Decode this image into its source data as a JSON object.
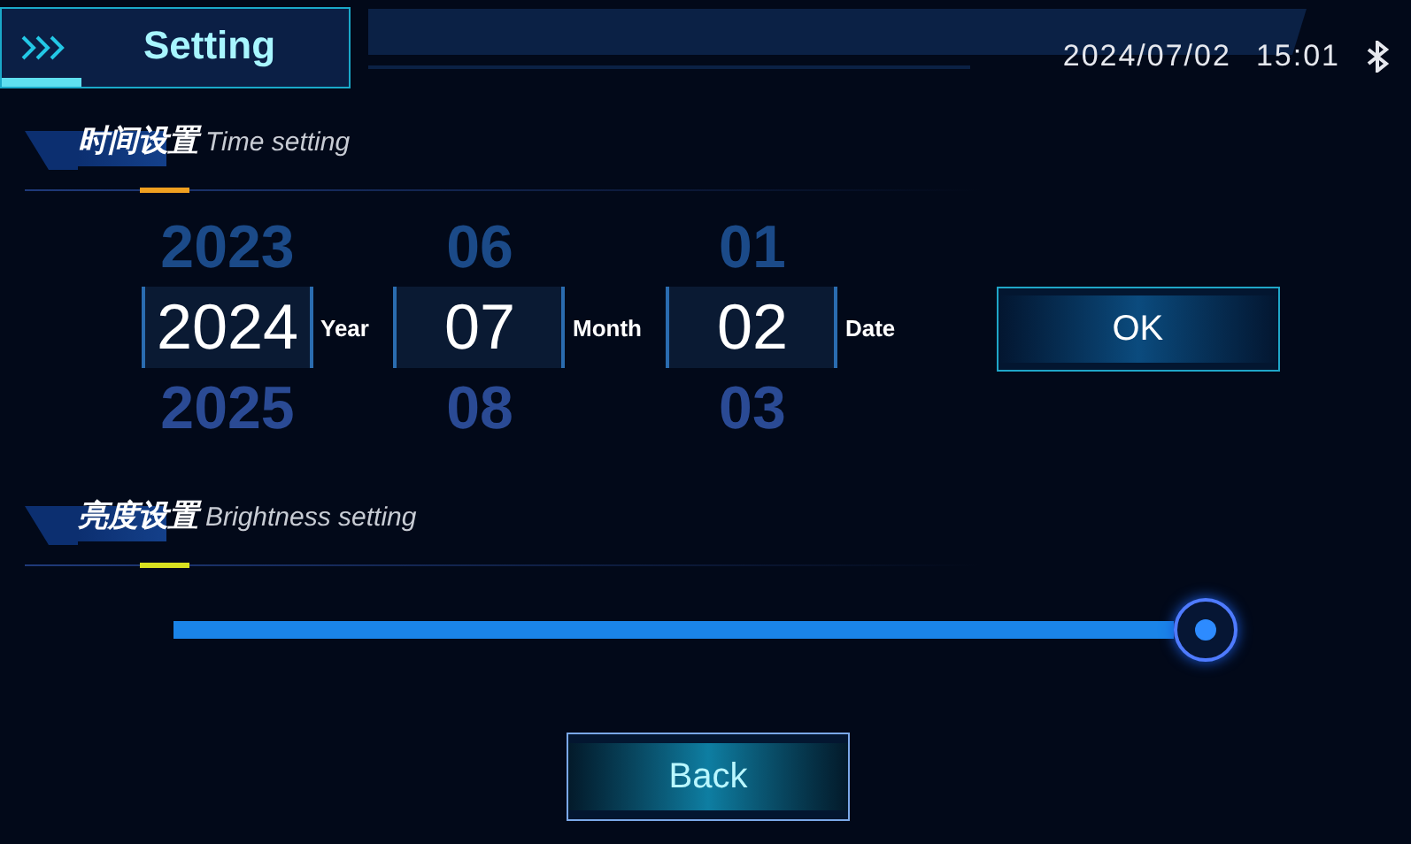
{
  "header": {
    "title": "Setting",
    "date": "2024/07/02",
    "time": "15:01"
  },
  "time_section": {
    "title": "时间设置",
    "subtitle": "Time setting"
  },
  "pickers": [
    {
      "previous": "2023",
      "value": "2024",
      "next": "2025",
      "label": "Year"
    },
    {
      "previous": "06",
      "value": "07",
      "next": "08",
      "label": "Month"
    },
    {
      "previous": "01",
      "value": "02",
      "next": "03",
      "label": "Date"
    }
  ],
  "ok_button": "OK",
  "brightness_section": {
    "title": "亮度设置",
    "subtitle": "Brightness setting"
  },
  "back_button": "Back"
}
